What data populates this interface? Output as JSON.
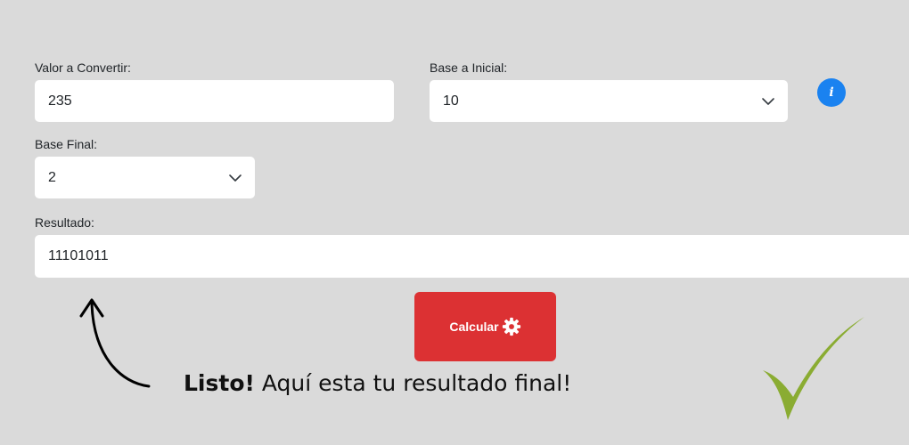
{
  "form": {
    "valor_label": "Valor a Convertir:",
    "valor_value": "235",
    "base_inicial_label": "Base a Inicial:",
    "base_inicial_value": "10",
    "base_final_label": "Base Final:",
    "base_final_value": "2",
    "resultado_label": "Resultado:",
    "resultado_value": "11101011"
  },
  "info_icon": {
    "glyph": "i",
    "icon": "info-icon",
    "color": "#1a82f0"
  },
  "calc_button": {
    "label": "Calcular",
    "icon": "gear-icon",
    "color": "#dc3133"
  },
  "annotation": {
    "bold": "Listo!",
    "text": "Aquí esta tu resultado final!",
    "arrow_icon": "curved-arrow-icon",
    "check_icon": "checkmark-icon",
    "check_color": "#8aac32"
  }
}
